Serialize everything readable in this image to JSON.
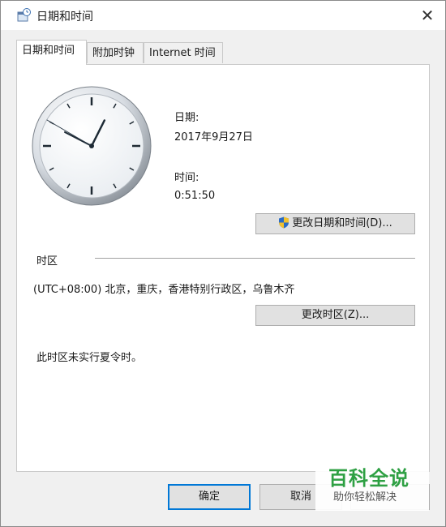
{
  "window": {
    "title": "日期和时间",
    "close_glyph": "✕",
    "icon": "clock-settings-icon"
  },
  "tabs": [
    {
      "label": "日期和时间",
      "active": true
    },
    {
      "label": "附加时钟",
      "active": false
    },
    {
      "label": "Internet 时间",
      "active": false
    }
  ],
  "datetime": {
    "date_label": "日期:",
    "date_value": "2017年9月27日",
    "time_label": "时间:",
    "time_value": "0:51:50",
    "change_button": "更改日期和时间(D)...",
    "change_button_icon": "uac-shield-icon"
  },
  "timezone": {
    "section_label": "时区",
    "value": "(UTC+08:00) 北京，重庆，香港特别行政区，乌鲁木齐",
    "change_button": "更改时区(Z)...",
    "dst_note": "此时区未实行夏令时。"
  },
  "footer": {
    "ok_label": "确定",
    "cancel_label": "取消"
  },
  "watermark": {
    "main": "百科全说",
    "sub": "助你轻松解决"
  },
  "colors": {
    "accent": "#0078d7",
    "watermark": "#2ea043"
  }
}
